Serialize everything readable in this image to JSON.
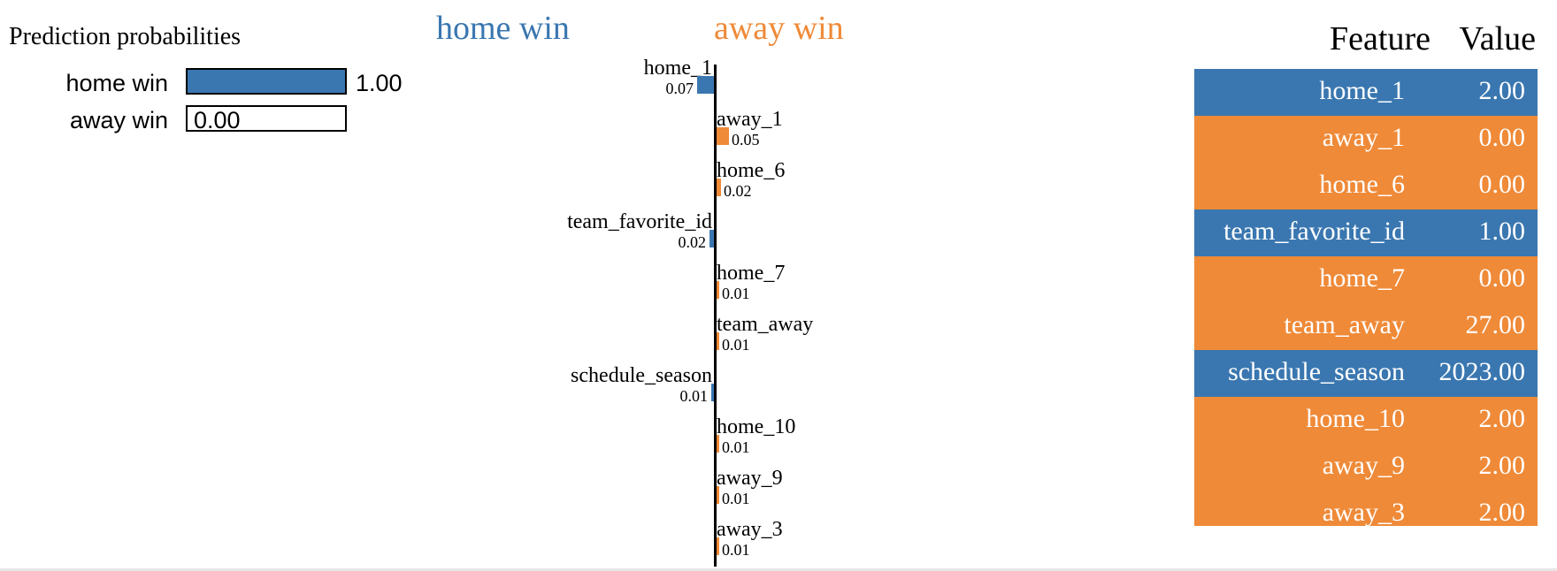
{
  "colors": {
    "home": "#3a77b0",
    "away": "#ef8a38"
  },
  "proba": {
    "title": "Prediction probabilities",
    "items": [
      {
        "label": "home win",
        "value_text": "1.00",
        "value": 1.0,
        "color": "#3a77b0"
      },
      {
        "label": "away win",
        "value_text": "0.00",
        "value": 0.0,
        "color": "#ef8a38"
      }
    ]
  },
  "explain": {
    "left_class": "home win",
    "right_class": "away win",
    "max_weight": 0.07,
    "features": [
      {
        "name": "home_1",
        "weight_text": "0.07",
        "weight": 0.07,
        "side": "left"
      },
      {
        "name": "away_1",
        "weight_text": "0.05",
        "weight": 0.05,
        "side": "right"
      },
      {
        "name": "home_6",
        "weight_text": "0.02",
        "weight": 0.02,
        "side": "right"
      },
      {
        "name": "team_favorite_id",
        "weight_text": "0.02",
        "weight": 0.02,
        "side": "left"
      },
      {
        "name": "home_7",
        "weight_text": "0.01",
        "weight": 0.01,
        "side": "right"
      },
      {
        "name": "team_away",
        "weight_text": "0.01",
        "weight": 0.01,
        "side": "right"
      },
      {
        "name": "schedule_season",
        "weight_text": "0.01",
        "weight": 0.01,
        "side": "left"
      },
      {
        "name": "home_10",
        "weight_text": "0.01",
        "weight": 0.01,
        "side": "right"
      },
      {
        "name": "away_9",
        "weight_text": "0.01",
        "weight": 0.01,
        "side": "right"
      },
      {
        "name": "away_3",
        "weight_text": "0.01",
        "weight": 0.01,
        "side": "right"
      }
    ]
  },
  "table": {
    "header": {
      "feature": "Feature",
      "value": "Value"
    },
    "rows": [
      {
        "feature": "home_1",
        "value": "2.00",
        "side": "home"
      },
      {
        "feature": "away_1",
        "value": "0.00",
        "side": "away"
      },
      {
        "feature": "home_6",
        "value": "0.00",
        "side": "away"
      },
      {
        "feature": "team_favorite_id",
        "value": "1.00",
        "side": "home"
      },
      {
        "feature": "home_7",
        "value": "0.00",
        "side": "away"
      },
      {
        "feature": "team_away",
        "value": "27.00",
        "side": "away"
      },
      {
        "feature": "schedule_season",
        "value": "2023.00",
        "side": "home"
      },
      {
        "feature": "home_10",
        "value": "2.00",
        "side": "away"
      },
      {
        "feature": "away_9",
        "value": "2.00",
        "side": "away"
      },
      {
        "feature": "away_3",
        "value": "2.00",
        "side": "away"
      }
    ]
  }
}
